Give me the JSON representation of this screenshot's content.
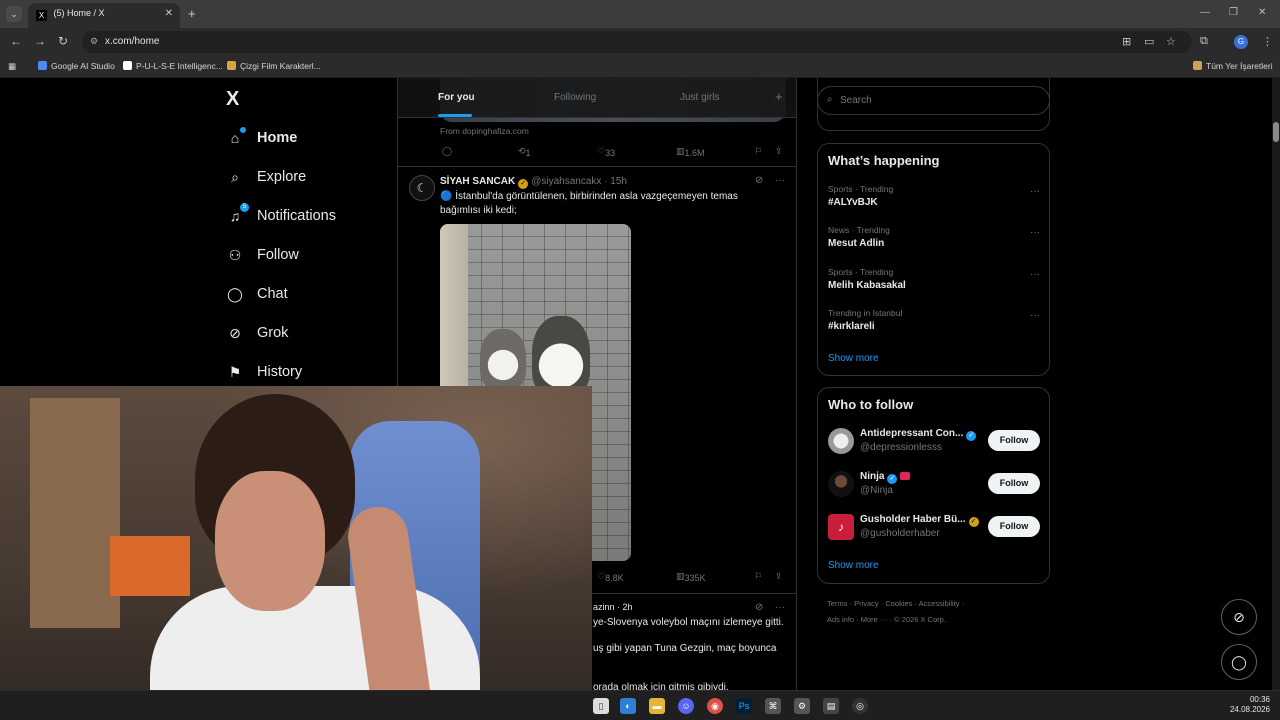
{
  "browser": {
    "tab_title": "(5) Home / X",
    "tab_favicon": "X",
    "tab_close": "✕",
    "new_tab": "+",
    "url": "x.com/home",
    "bookmarks": [
      "Google AI Studio",
      "P-U-L-S-E Intelligenc...",
      "Çizgi Film Karakterl..."
    ],
    "all_bookmarks": "Tüm Yer İşaretleri",
    "profile_initial": "G",
    "icons": [
      "back-icon",
      "forward-icon",
      "reload-icon",
      "translate-icon",
      "cast-icon",
      "star-icon",
      "extensions-icon",
      "menu-icon"
    ]
  },
  "sidebar": {
    "logo": "X",
    "items": [
      {
        "label": "Home",
        "icon": "home-icon"
      },
      {
        "label": "Explore",
        "icon": "search-icon"
      },
      {
        "label": "Notifications",
        "icon": "bell-icon",
        "badge": "5"
      },
      {
        "label": "Follow",
        "icon": "person-plus-icon"
      },
      {
        "label": "Chat",
        "icon": "chat-icon"
      },
      {
        "label": "Grok",
        "icon": "grok-icon"
      },
      {
        "label": "History",
        "icon": "bookmark-icon"
      }
    ]
  },
  "timeline": {
    "tabs": [
      "For you",
      "Following",
      "Just girls"
    ],
    "add_tab": "+",
    "post1": {
      "source": "From dopinghafiza.com",
      "retweets": "1",
      "likes": "33",
      "views": "1.6M"
    },
    "post2": {
      "name": "SİYAH SANCAK",
      "handle": "@siyahsancakx",
      "time": "· 15h",
      "text": "🔵 İstanbul'da görüntülenen, birbirinden asla vazgeçemeyen temas bağımlısı iki kedi;",
      "likes": "8.8K",
      "views": "335K"
    },
    "post3": {
      "meta": "azinn · 2h",
      "line1": "ye-Slovenya voleybol maçını izlemeye gitti.",
      "line2": "uş gibi yapan Tuna Gezgin, maç boyunca",
      "line3": "orada olmak için gitmiş gibiydi."
    }
  },
  "right": {
    "search_placeholder": "Search",
    "happening_title": "What’s happening",
    "trends": [
      {
        "meta": "Sports · Trending",
        "name": "#ALYvBJK"
      },
      {
        "meta": "News · Trending",
        "name": "Mesut Adlin"
      },
      {
        "meta": "Sports · Trending",
        "name": "Melih Kabasakal"
      },
      {
        "meta": "Trending in Istanbul",
        "name": "#kırklareli"
      }
    ],
    "show_more": "Show more",
    "who_title": "Who to follow",
    "follow_label": "Follow",
    "who": [
      {
        "name": "Antidepressant Con...",
        "handle": "@depressionlesss",
        "badge": "blue"
      },
      {
        "name": "Ninja",
        "handle": "@Ninja",
        "badge": "blue"
      },
      {
        "name": "Gusholder Haber Bü...",
        "handle": "@gusholderhaber",
        "badge": "gold"
      }
    ],
    "footer_line1": "Terms  ·  Privacy  ·  Cookies  ·  Accessibility  ·",
    "footer_line2": "Ads info  ·  More ···  · © 2026 X Corp."
  },
  "taskbar": {
    "time": "00:36",
    "date": "24.08.2026",
    "discord_badge": "1"
  }
}
